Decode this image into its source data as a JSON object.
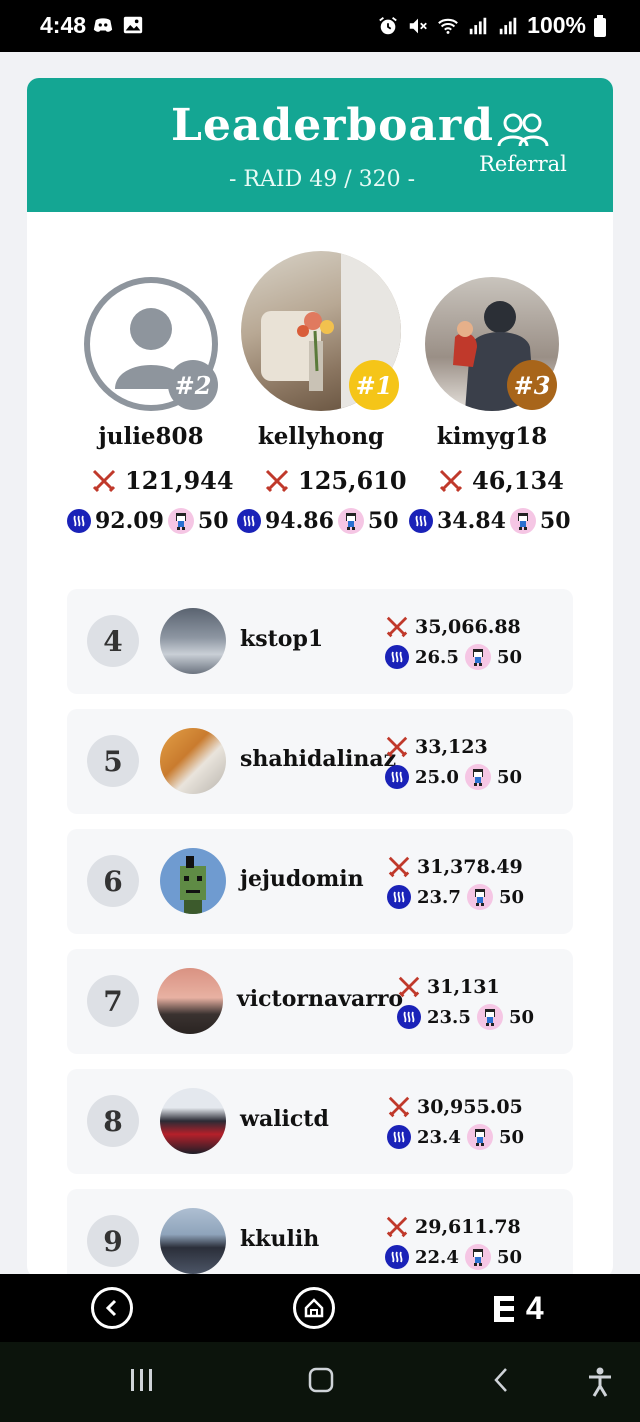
{
  "status_bar": {
    "time": "4:48",
    "battery": "100%"
  },
  "header": {
    "title": "Leaderboard",
    "subtitle": "- RAID 49 / 320 -",
    "referral_label": "Referral"
  },
  "podium": [
    {
      "position": 2,
      "badge": "#2",
      "username": "julie808",
      "score": "121,944",
      "steem": "92.09",
      "mascot": "50",
      "badge_color": "#8e959d"
    },
    {
      "position": 1,
      "badge": "#1",
      "username": "kellyhong",
      "score": "125,610",
      "steem": "94.86",
      "mascot": "50",
      "badge_color": "#f5c518"
    },
    {
      "position": 3,
      "badge": "#3",
      "username": "kimyg18",
      "score": "46,134",
      "steem": "34.84",
      "mascot": "50",
      "badge_color": "#a8651a"
    }
  ],
  "rows": [
    {
      "rank": "4",
      "username": "kstop1",
      "score": "35,066.88",
      "steem": "26.5",
      "mascot": "50"
    },
    {
      "rank": "5",
      "username": "shahidalinaz",
      "score": "33,123",
      "steem": "25.0",
      "mascot": "50"
    },
    {
      "rank": "6",
      "username": "jejudomin",
      "score": "31,378.49",
      "steem": "23.7",
      "mascot": "50"
    },
    {
      "rank": "7",
      "username": "victornavarro",
      "score": "31,131",
      "steem": "23.5",
      "mascot": "50"
    },
    {
      "rank": "8",
      "username": "walictd",
      "score": "30,955.05",
      "steem": "23.4",
      "mascot": "50"
    },
    {
      "rank": "9",
      "username": "kkulih",
      "score": "29,611.78",
      "steem": "22.4",
      "mascot": "50"
    }
  ],
  "app_nav": {
    "logo": "4"
  },
  "colors": {
    "accent": "#14a693",
    "steem": "#1a22b8",
    "sword": "#c0392b"
  }
}
